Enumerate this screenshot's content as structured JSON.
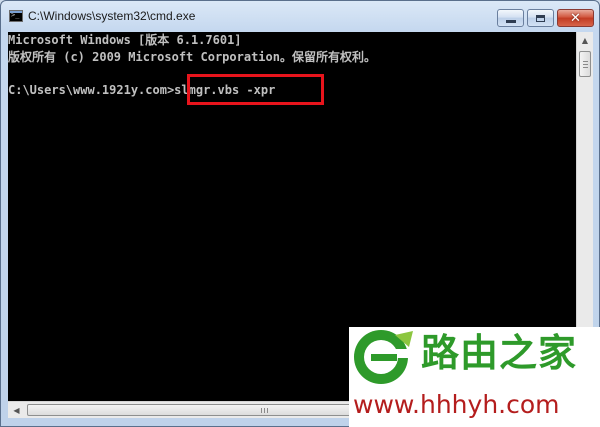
{
  "window": {
    "title": "C:\\Windows\\system32\\cmd.exe",
    "icon": "cmd-icon",
    "controls": {
      "minimize_icon": "minimize-icon",
      "maximize_icon": "maximize-icon",
      "close_icon": "close-icon",
      "close_glyph": "✕"
    }
  },
  "console": {
    "lines": [
      "Microsoft Windows [版本 6.1.7601]",
      "版权所有 (c) 2009 Microsoft Corporation。保留所有权利。",
      "C:\\Users\\www.1921y.com>slmgr.vbs -xpr"
    ],
    "text_color": "#c0c0c0",
    "background": "#000000",
    "highlight_color": "#e8141c"
  },
  "watermark": {
    "name": "路由之家",
    "url": "www.hhhyh.com",
    "colors": {
      "green": "#2e9a2a",
      "red": "#b41d1d"
    }
  }
}
